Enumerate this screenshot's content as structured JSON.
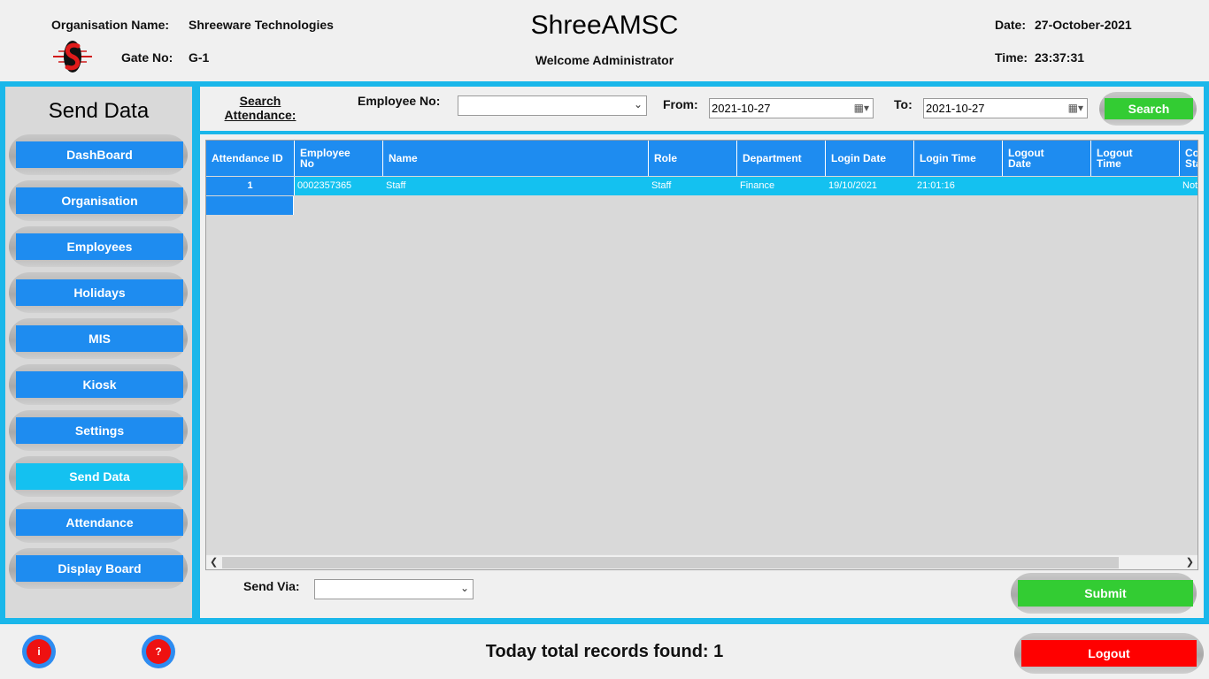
{
  "header": {
    "org_label": "Organisation Name:",
    "org_value": "Shreeware Technologies",
    "gate_label": "Gate No:",
    "gate_value": "G-1",
    "app_title": "ShreeAMSC",
    "welcome": "Welcome Administrator",
    "date_label": "Date:",
    "date_value": "27-October-2021",
    "time_label": "Time:",
    "time_value": "23:37:31",
    "logo_icon": "shreeware-logo-icon"
  },
  "sidebar": {
    "title": "Send Data",
    "items": [
      {
        "label": "DashBoard"
      },
      {
        "label": "Organisation"
      },
      {
        "label": "Employees"
      },
      {
        "label": "Holidays"
      },
      {
        "label": "MIS"
      },
      {
        "label": "Kiosk"
      },
      {
        "label": "Settings"
      },
      {
        "label": "Send Data",
        "active": true
      },
      {
        "label": "Attendance"
      },
      {
        "label": "Display Board"
      }
    ]
  },
  "search": {
    "section_label": "Search Attendance:",
    "employee_label": "Employee No:",
    "employee_value": "",
    "from_label": "From:",
    "from_value": "2021-10-27",
    "to_label": "To:",
    "to_value": "2021-10-27",
    "search_button": "Search"
  },
  "grid": {
    "columns": [
      "Attendance ID",
      "Employee\nNo",
      "Name",
      "Role",
      "Department",
      "Login Date",
      "Login Time",
      "Logout\nDate",
      "Logout\nTime",
      "Co\nSta"
    ],
    "rows": [
      [
        "1",
        "0002357365",
        "Staff",
        "Staff",
        "Finance",
        "19/10/2021",
        "21:01:16",
        "",
        "",
        "Not"
      ]
    ]
  },
  "send_via": {
    "label": "Send Via:",
    "value": ""
  },
  "submit_button": "Submit",
  "footer": {
    "info_icon_label": "i",
    "help_icon_label": "?",
    "records_text": "Today total records found: 1",
    "logout_button": "Logout"
  },
  "colors": {
    "accent_blue": "#1e8cf0",
    "frame_cyan": "#1ab7ea",
    "success_green": "#33cc33",
    "danger_red": "#ff0000"
  }
}
